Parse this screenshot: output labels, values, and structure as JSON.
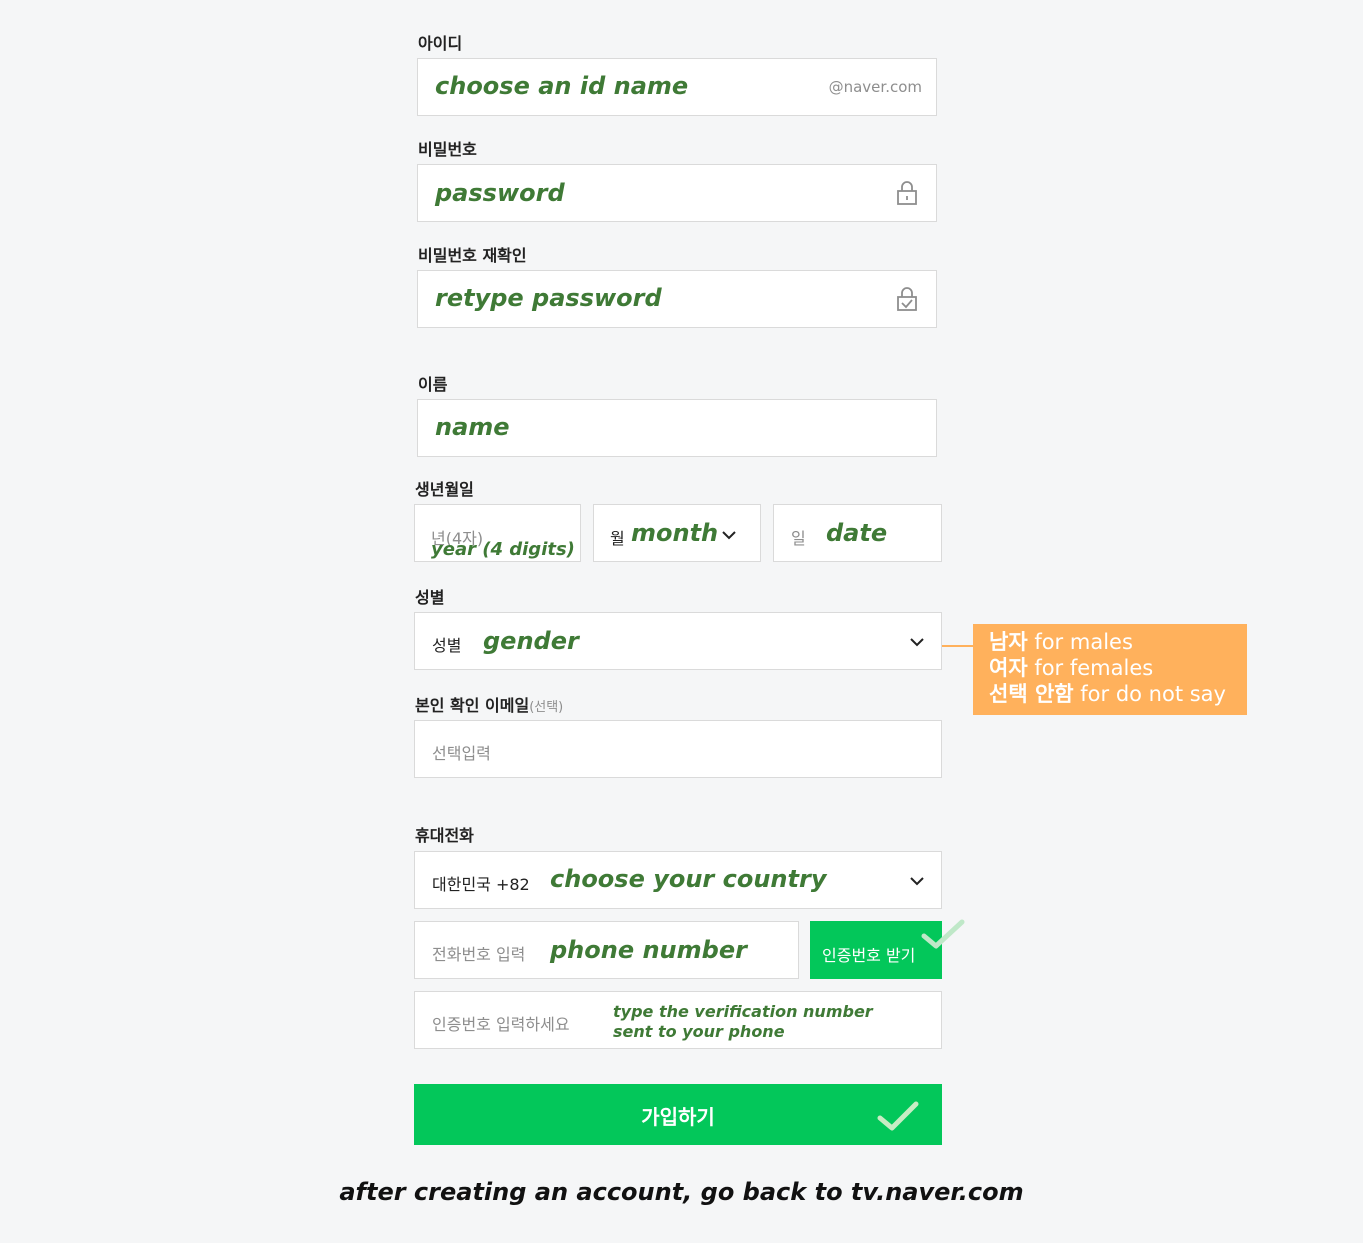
{
  "fields": {
    "id": {
      "label": "아이디",
      "annotation": "choose an id name",
      "suffix": "@naver.com"
    },
    "password": {
      "label": "비밀번호",
      "annotation": "password",
      "icon": "lock-icon"
    },
    "password_confirm": {
      "label": "비밀번호 재확인",
      "annotation": "retype password",
      "icon": "lock-check-icon"
    },
    "name": {
      "label": "이름",
      "annotation": "name"
    },
    "birth": {
      "label": "생년월일",
      "year_placeholder": "년(4자)",
      "year_annotation": "year (4 digits)",
      "month_placeholder": "월",
      "month_annotation": "month",
      "day_placeholder": "일",
      "day_annotation": "date"
    },
    "gender": {
      "label": "성별",
      "placeholder": "성별",
      "annotation": "gender"
    },
    "email": {
      "label": "본인 확인 이메일",
      "label_optional": "(선택)",
      "placeholder": "선택입력"
    },
    "phone": {
      "label": "휴대전화",
      "country_value": "대한민국 +82",
      "country_annotation": "choose your country",
      "number_placeholder": "전화번호 입력",
      "number_annotation": "phone number",
      "verify_button": "인증번호 받기",
      "code_placeholder": "인증번호 입력하세요",
      "code_annotation_line1": "type the verification number",
      "code_annotation_line2": "sent to your phone"
    }
  },
  "gender_note": {
    "line1_ko": "남자",
    "line1_en": " for males",
    "line2_ko": "여자",
    "line2_en": " for females",
    "line3_ko": "선택 안함",
    "line3_en": " for do not say"
  },
  "submit_label": "가입하기",
  "footer": "after creating an account, go back to tv.naver.com",
  "colors": {
    "accent": "#03c75a",
    "annotation": "#3f7a36",
    "note": "#ffb15c"
  }
}
